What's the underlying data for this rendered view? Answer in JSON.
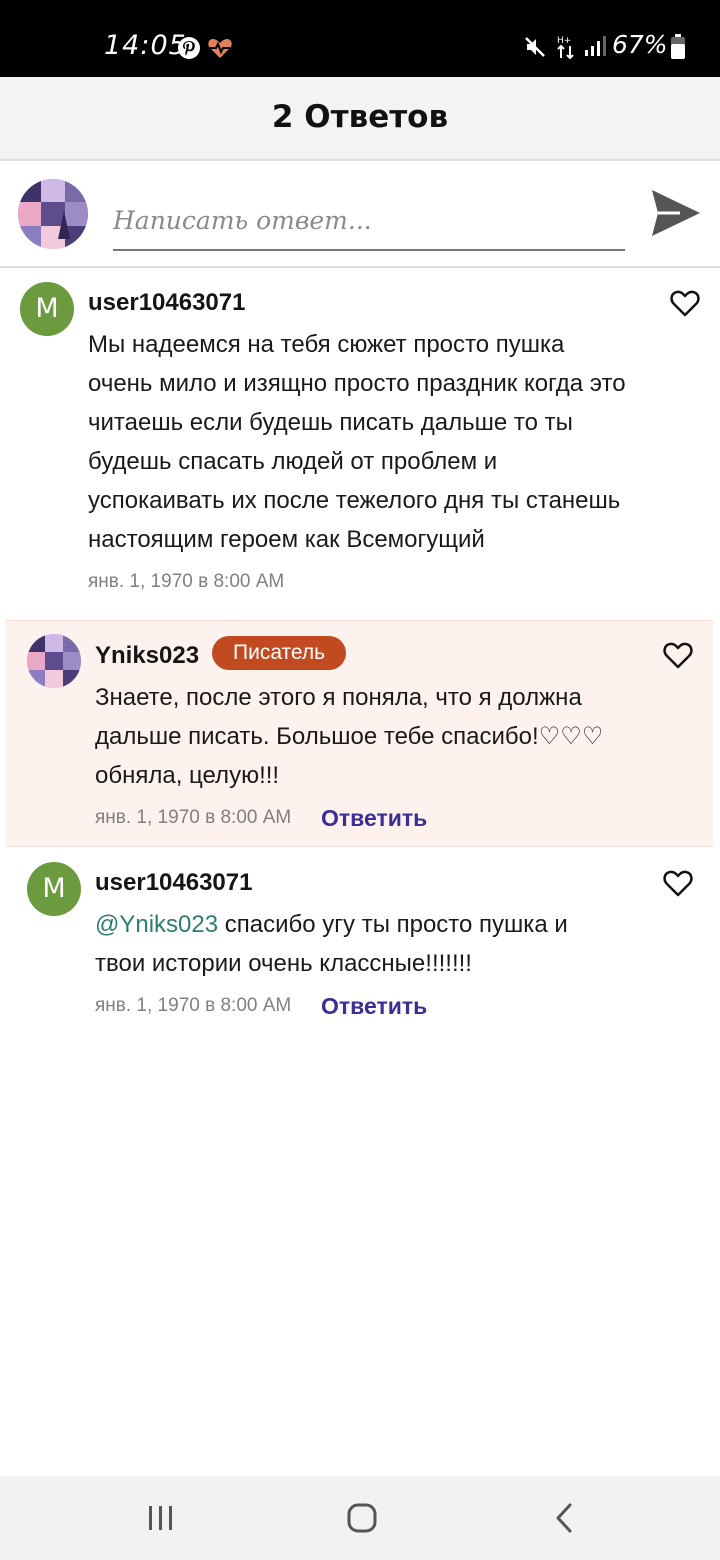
{
  "status_bar": {
    "time": "14:05",
    "battery": "67%",
    "icons": [
      "pinterest-icon",
      "heart-rate-icon",
      "mute-icon",
      "data-arrows-icon",
      "signal-icon",
      "battery-icon"
    ]
  },
  "header": {
    "title": "2 Ответов"
  },
  "composer": {
    "placeholder": "Написать ответ..."
  },
  "comments": [
    {
      "avatar_letter": "M",
      "username": "user10463071",
      "text": "Мы надеемся на тебя сюжет просто пушка очень мило и изящно просто праздник когда это читаешь если будешь писать дальше то ты будешь спасать людей от проблем и успокаивать их после тежелого дня ты станешь настоящим героем как Всемогущий",
      "timestamp": "янв. 1, 1970 в 8:00 AM"
    },
    {
      "username": "Yniks023",
      "badge": "Писатель",
      "text": "Знаете, после этого я поняла, что я должна дальше писать. Большое тебе спасибо!♡♡♡ обняла, целую!!!",
      "timestamp": "янв. 1, 1970 в 8:00 AM",
      "reply_label": "Ответить"
    },
    {
      "avatar_letter": "M",
      "username": "user10463071",
      "mention": "@Yniks023",
      "text": " спасибо угу ты просто пушка и твои истории очень классные!!!!!!!",
      "timestamp": "янв. 1, 1970 в 8:00 AM",
      "reply_label": "Ответить"
    }
  ],
  "colors": {
    "accent_link": "#3b2e96",
    "badge": "#c24a20",
    "highlight_bg": "#fdf2ee",
    "avatar_green": "#6b9a3f"
  }
}
